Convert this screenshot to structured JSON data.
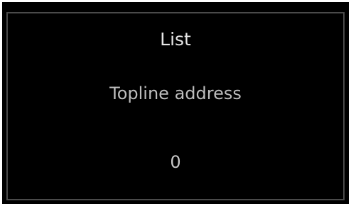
{
  "dialog": {
    "title": "List",
    "label": "Topline address",
    "value": "0"
  },
  "colors": {
    "background": "#000000",
    "text": "#d9d9d9",
    "border": "#4a4a4a"
  }
}
